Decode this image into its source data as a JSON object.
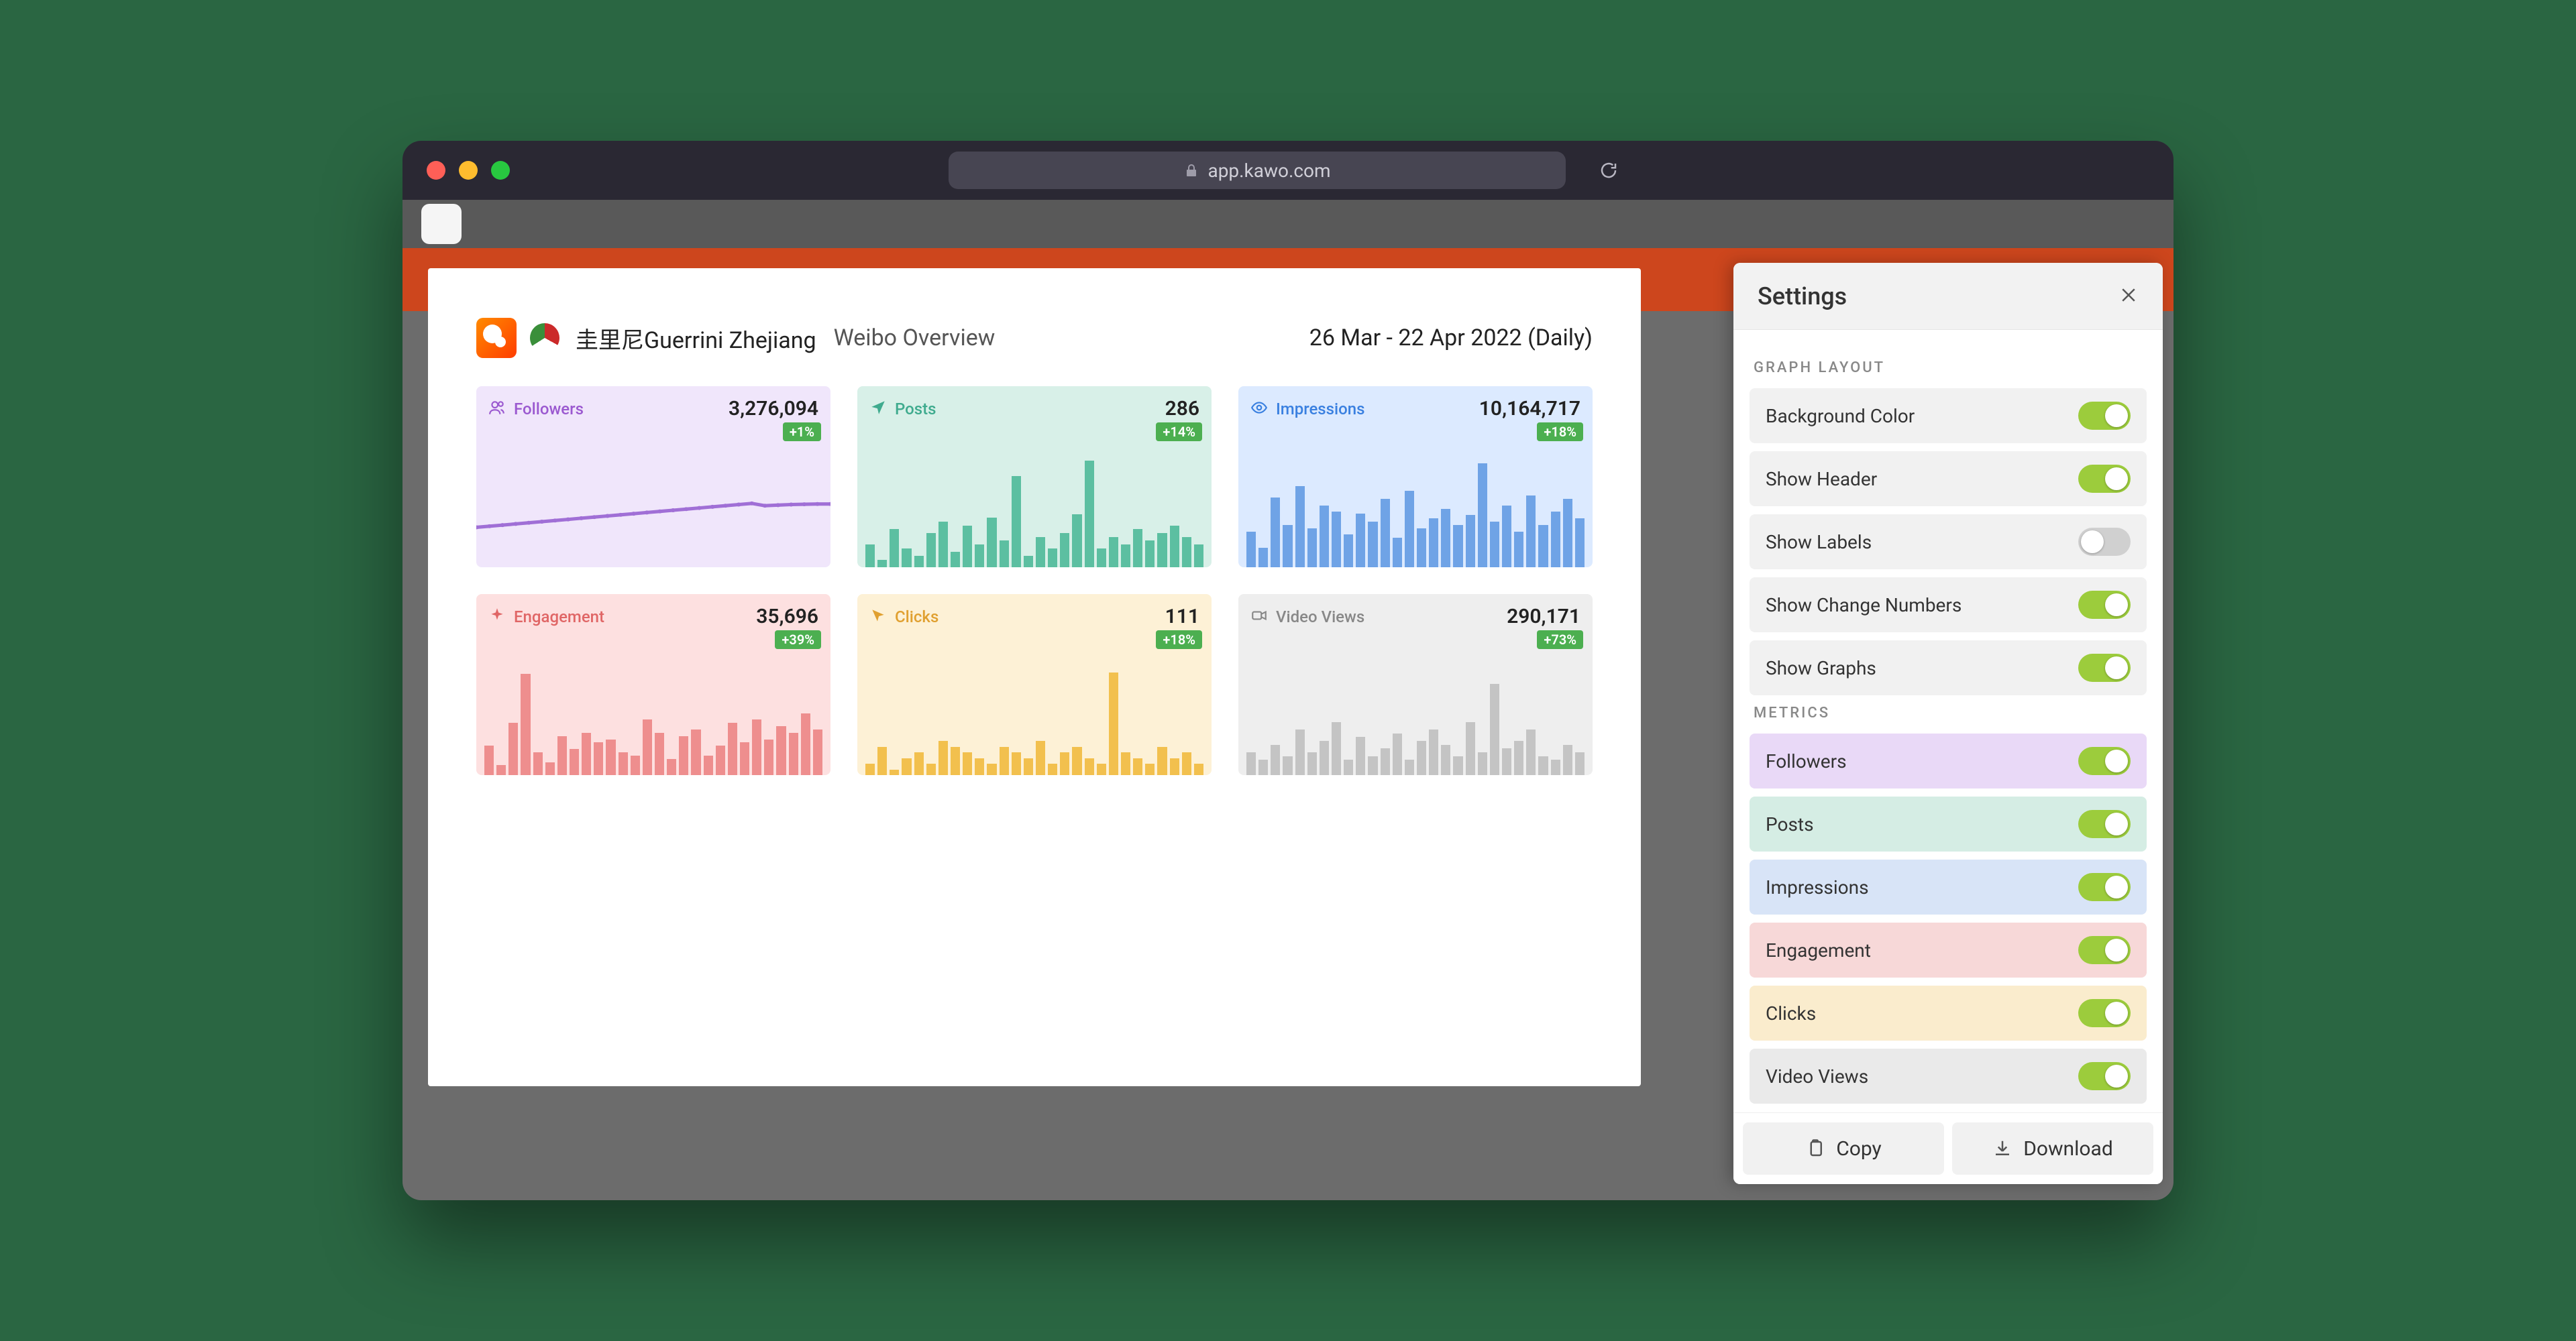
{
  "browser": {
    "url": "app.kawo.com"
  },
  "overview": {
    "account": "圭里尼Guerrini Zhejiang",
    "title": "Weibo Overview",
    "date_range": "26 Mar - 22 Apr 2022 (Daily)"
  },
  "metrics": [
    {
      "key": "followers",
      "label": "Followers",
      "value": "3,276,094",
      "change": "+1%",
      "type": "line",
      "tint": "purple",
      "icon": "users-icon"
    },
    {
      "key": "posts",
      "label": "Posts",
      "value": "286",
      "change": "+14%",
      "type": "bar",
      "tint": "teal",
      "icon": "send-icon"
    },
    {
      "key": "impressions",
      "label": "Impressions",
      "value": "10,164,717",
      "change": "+18%",
      "type": "bar",
      "tint": "blue",
      "icon": "eye-icon"
    },
    {
      "key": "engagement",
      "label": "Engagement",
      "value": "35,696",
      "change": "+39%",
      "type": "bar",
      "tint": "pink",
      "icon": "sparkle-icon"
    },
    {
      "key": "clicks",
      "label": "Clicks",
      "value": "111",
      "change": "+18%",
      "type": "bar",
      "tint": "amber",
      "icon": "cursor-icon"
    },
    {
      "key": "videoviews",
      "label": "Video Views",
      "value": "290,171",
      "change": "+73%",
      "type": "bar",
      "tint": "grey",
      "icon": "video-icon"
    }
  ],
  "settings": {
    "title": "Settings",
    "sections": {
      "graph_layout": "GRAPH LAYOUT",
      "metrics": "METRICS"
    },
    "layout_options": [
      {
        "label": "Background Color",
        "on": true
      },
      {
        "label": "Show Header",
        "on": true
      },
      {
        "label": "Show Labels",
        "on": false
      },
      {
        "label": "Show Change Numbers",
        "on": true
      },
      {
        "label": "Show Graphs",
        "on": true
      }
    ],
    "metric_toggles": [
      {
        "label": "Followers",
        "on": true,
        "cls": "m-followers"
      },
      {
        "label": "Posts",
        "on": true,
        "cls": "m-posts"
      },
      {
        "label": "Impressions",
        "on": true,
        "cls": "m-impressions"
      },
      {
        "label": "Engagement",
        "on": true,
        "cls": "m-engagement"
      },
      {
        "label": "Clicks",
        "on": true,
        "cls": "m-clicks"
      },
      {
        "label": "Video Views",
        "on": true,
        "cls": "m-videoviews"
      }
    ],
    "footer": {
      "copy": "Copy",
      "download": "Download"
    }
  },
  "chart_data": [
    {
      "metric": "followers",
      "type": "line",
      "ylim": [
        3270000,
        3280000
      ],
      "values": [
        3272000,
        3272200,
        3272400,
        3272600,
        3272800,
        3273000,
        3273200,
        3273400,
        3273600,
        3273800,
        3274000,
        3274200,
        3274400,
        3274600,
        3274800,
        3275000,
        3275200,
        3275400,
        3275600,
        3275800,
        3276000,
        3276200,
        3275800,
        3275900,
        3276000,
        3276050,
        3276094,
        3276094
      ]
    },
    {
      "metric": "posts",
      "type": "bar",
      "ylim": [
        0,
        30
      ],
      "values": [
        6,
        2,
        10,
        5,
        3,
        9,
        12,
        4,
        11,
        6,
        13,
        7,
        24,
        3,
        8,
        5,
        9,
        14,
        28,
        5,
        8,
        6,
        10,
        7,
        9,
        11,
        8,
        6
      ]
    },
    {
      "metric": "impressions",
      "type": "bar",
      "ylim": [
        0,
        700000
      ],
      "values": [
        220000,
        120000,
        430000,
        260000,
        500000,
        240000,
        380000,
        340000,
        200000,
        330000,
        280000,
        420000,
        180000,
        470000,
        240000,
        300000,
        360000,
        260000,
        320000,
        640000,
        280000,
        380000,
        220000,
        440000,
        260000,
        340000,
        420000,
        300000
      ]
    },
    {
      "metric": "engagement",
      "type": "bar",
      "ylim": [
        0,
        3500
      ],
      "values": [
        900,
        300,
        1600,
        3100,
        700,
        400,
        1200,
        800,
        1300,
        1000,
        1100,
        700,
        600,
        1700,
        1300,
        500,
        1200,
        1400,
        600,
        900,
        1600,
        1000,
        1700,
        1100,
        1500,
        1300,
        1900,
        1400
      ]
    },
    {
      "metric": "clicks",
      "type": "bar",
      "ylim": [
        0,
        20
      ],
      "values": [
        2,
        5,
        1,
        3,
        4,
        2,
        6,
        5,
        4,
        3,
        2,
        5,
        4,
        3,
        6,
        2,
        4,
        5,
        3,
        2,
        18,
        4,
        3,
        2,
        5,
        3,
        4,
        2
      ]
    },
    {
      "metric": "videoviews",
      "type": "bar",
      "ylim": [
        0,
        30000
      ],
      "values": [
        6000,
        4000,
        8000,
        5000,
        12000,
        6000,
        9000,
        14000,
        4000,
        10000,
        5000,
        7000,
        11000,
        4000,
        9000,
        12000,
        8000,
        5000,
        14000,
        6000,
        24000,
        7000,
        9000,
        12000,
        5000,
        4000,
        8000,
        6000
      ]
    }
  ],
  "bar_colors": {
    "teal": "#5cbfa1",
    "blue": "#6fa3e6",
    "pink": "#ee8e8e",
    "amber": "#f2c04e",
    "grey": "#c4c4c4",
    "purple": "#a06fd6"
  }
}
